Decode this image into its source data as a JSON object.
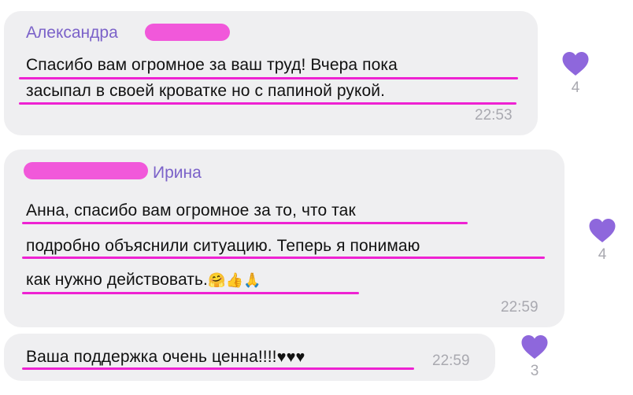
{
  "colors": {
    "bubble": "#efeff1",
    "sender": "#7b62c9",
    "accent_heart": "#8e67dc",
    "underline": "#ee22d2",
    "time": "#a9a9b0"
  },
  "messages": [
    {
      "sender": "Александра",
      "lines": [
        "Спасибо вам огромное за ваш труд! Вчера пока",
        "засыпал в своей кроватке но с папиной рукой."
      ],
      "time": "22:53",
      "likes": "4"
    },
    {
      "sender": "Ирина",
      "lines": [
        "Анна, спасибо вам огромное за то, что так",
        "подробно объяснили ситуацию. Теперь я понимаю",
        "как нужно действовать."
      ],
      "emojis": "🤗👍🙏",
      "time": "22:59",
      "likes": "4"
    },
    {
      "lines": [
        "Ваша поддержка очень ценна!!!!"
      ],
      "hearts": "♥♥♥",
      "time": "22:59",
      "likes": "3"
    }
  ]
}
